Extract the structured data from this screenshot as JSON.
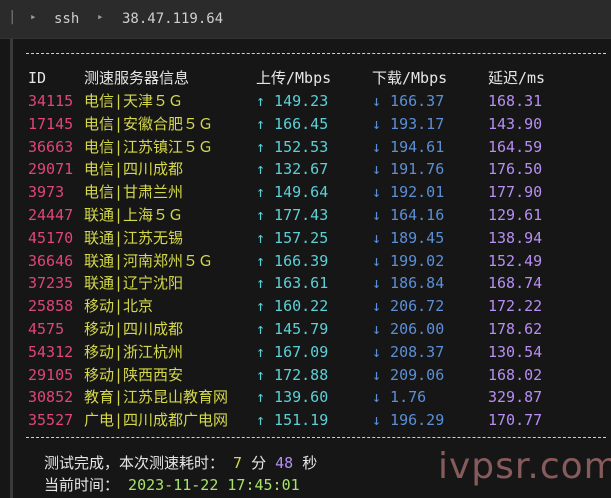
{
  "tabbar": {
    "pipe": "|",
    "crumbs": [
      "ssh",
      "38.47.119.64"
    ]
  },
  "separator": "--------------------------------------------------------------------",
  "headers": {
    "id": "ID",
    "node": "测速服务器信息",
    "upload": "上传/Mbps",
    "download": "下载/Mbps",
    "latency": "延迟/ms"
  },
  "rows": [
    {
      "id": "34115",
      "node": "电信|天津５Ｇ",
      "up": "↑ 149.23",
      "down": "↓ 166.37",
      "lat": "168.31"
    },
    {
      "id": "17145",
      "node": "电信|安徽合肥５Ｇ",
      "up": "↑ 166.45",
      "down": "↓ 193.17",
      "lat": "143.90"
    },
    {
      "id": "36663",
      "node": "电信|江苏镇江５Ｇ",
      "up": "↑ 152.53",
      "down": "↓ 194.61",
      "lat": "164.59"
    },
    {
      "id": "29071",
      "node": "电信|四川成都",
      "up": "↑ 132.67",
      "down": "↓ 191.76",
      "lat": "176.50"
    },
    {
      "id": "3973",
      "node": "电信|甘肃兰州",
      "up": "↑ 149.64",
      "down": "↓ 192.01",
      "lat": "177.90"
    },
    {
      "id": "24447",
      "node": "联通|上海５Ｇ",
      "up": "↑ 177.43",
      "down": "↓ 164.16",
      "lat": "129.61"
    },
    {
      "id": "45170",
      "node": "联通|江苏无锡",
      "up": "↑ 157.25",
      "down": "↓ 189.45",
      "lat": "138.94"
    },
    {
      "id": "36646",
      "node": "联通|河南郑州５Ｇ",
      "up": "↑ 166.39",
      "down": "↓ 199.02",
      "lat": "152.49"
    },
    {
      "id": "37235",
      "node": "联通|辽宁沈阳",
      "up": "↑ 163.61",
      "down": "↓ 186.84",
      "lat": "168.74"
    },
    {
      "id": "25858",
      "node": "移动|北京",
      "up": "↑ 160.22",
      "down": "↓ 206.72",
      "lat": "172.22"
    },
    {
      "id": "4575",
      "node": "移动|四川成都",
      "up": "↑ 145.79",
      "down": "↓ 206.00",
      "lat": "178.62"
    },
    {
      "id": "54312",
      "node": "移动|浙江杭州",
      "up": "↑ 167.09",
      "down": "↓ 208.37",
      "lat": "130.54"
    },
    {
      "id": "29105",
      "node": "移动|陕西西安",
      "up": "↑ 172.88",
      "down": "↓ 209.06",
      "lat": "168.02"
    },
    {
      "id": "30852",
      "node": "教育|江苏昆山教育网",
      "up": "↑ 139.60",
      "down": "↓ 1.76",
      "lat": "329.87"
    },
    {
      "id": "35527",
      "node": "广电|四川成都广电网",
      "up": "↑ 151.19",
      "down": "↓ 196.29",
      "lat": "170.77"
    }
  ],
  "footer": {
    "done_label": "测试完成，本次测速耗时：",
    "minutes": "7",
    "minutes_unit": "分",
    "seconds": "48",
    "seconds_unit": "秒",
    "time_label": "当前时间：",
    "time_value": "2023-11-22 17:45:01"
  },
  "watermark": "ivpsr.com",
  "colors": {
    "id": "#e0457b",
    "node": "#d4d84a",
    "upload": "#5bd1d7",
    "download": "#5b8fd8",
    "latency": "#b78ef2",
    "time": "#a6e36a"
  }
}
